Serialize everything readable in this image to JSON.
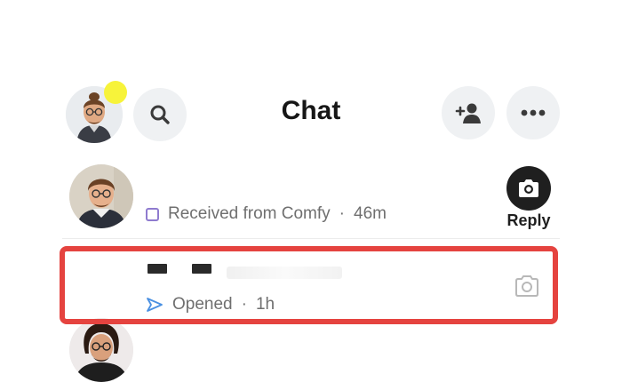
{
  "header": {
    "title": "Chat",
    "avatar_icon": "bitmoji-avatar",
    "search_icon": "search-icon",
    "add_friend_icon": "add-friend-icon",
    "more_icon": "more-icon",
    "notif_color": "#f7f33a"
  },
  "chats": [
    {
      "status_icon": "received-square-icon",
      "status_text": "Received from Comfy",
      "separator": "·",
      "time": "46m",
      "action": {
        "icon": "camera-icon",
        "label": "Reply"
      }
    },
    {
      "status_icon": "sent-arrow-icon",
      "status_text": "Opened",
      "separator": "·",
      "time": "1h",
      "action": {
        "icon": "camera-outline-icon"
      }
    }
  ],
  "colors": {
    "highlight": "#e5433f",
    "received": "#8f7bcf",
    "sent": "#4a90e2"
  }
}
